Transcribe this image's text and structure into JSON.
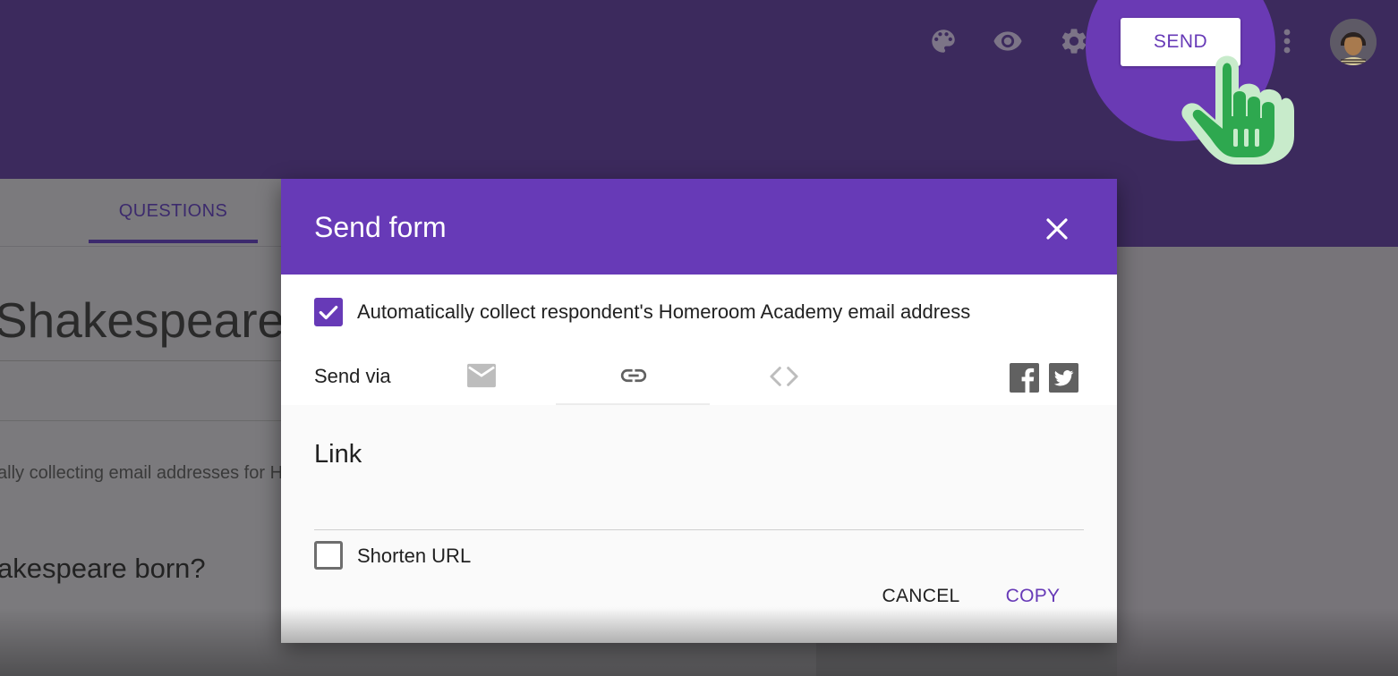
{
  "header": {
    "icons": [
      "palette-icon",
      "eye-icon",
      "gear-icon",
      "more-vert-icon"
    ],
    "send_label": "SEND",
    "colors": {
      "bar": "#3c2a5d",
      "accent": "#673ab7"
    }
  },
  "background": {
    "tab_questions": "QUESTIONS",
    "form_title": "Shakespeare C",
    "note": "ally collecting email addresses for H",
    "question": "akespeare born?"
  },
  "dialog": {
    "title": "Send form",
    "collect_label": "Automatically collect respondent's Homeroom Academy email address",
    "collect_checked": true,
    "send_via_label": "Send via",
    "send_via_icons": [
      "email-icon",
      "link-icon",
      "embed-icon",
      "facebook-icon",
      "twitter-icon"
    ],
    "active_method": "link-icon",
    "link_heading": "Link",
    "link_value": "",
    "shorten_label": "Shorten URL",
    "shorten_checked": false,
    "cancel_label": "CANCEL",
    "copy_label": "COPY"
  }
}
